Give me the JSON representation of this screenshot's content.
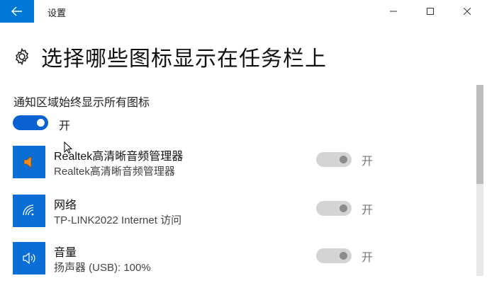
{
  "window": {
    "app_title": "设置"
  },
  "header": {
    "title": "选择哪些图标显示在任务栏上"
  },
  "master": {
    "label": "通知区域始终显示所有图标",
    "state_label": "开",
    "on": true
  },
  "items": [
    {
      "name": "Realtek高清晰音频管理器",
      "desc": "Realtek高清晰音频管理器",
      "state_label": "开",
      "icon": "speaker-orange-icon"
    },
    {
      "name": "网络",
      "desc": "TP-LINK2022 Internet 访问",
      "state_label": "开",
      "icon": "wifi-icon"
    },
    {
      "name": "音量",
      "desc": "扬声器 (USB): 100%",
      "state_label": "开",
      "icon": "volume-icon"
    }
  ],
  "colors": {
    "accent": "#0078d7",
    "toggle_on": "#0a62d2",
    "tile": "#0b6ed6",
    "toggle_disabled": "#d4d4d4"
  }
}
